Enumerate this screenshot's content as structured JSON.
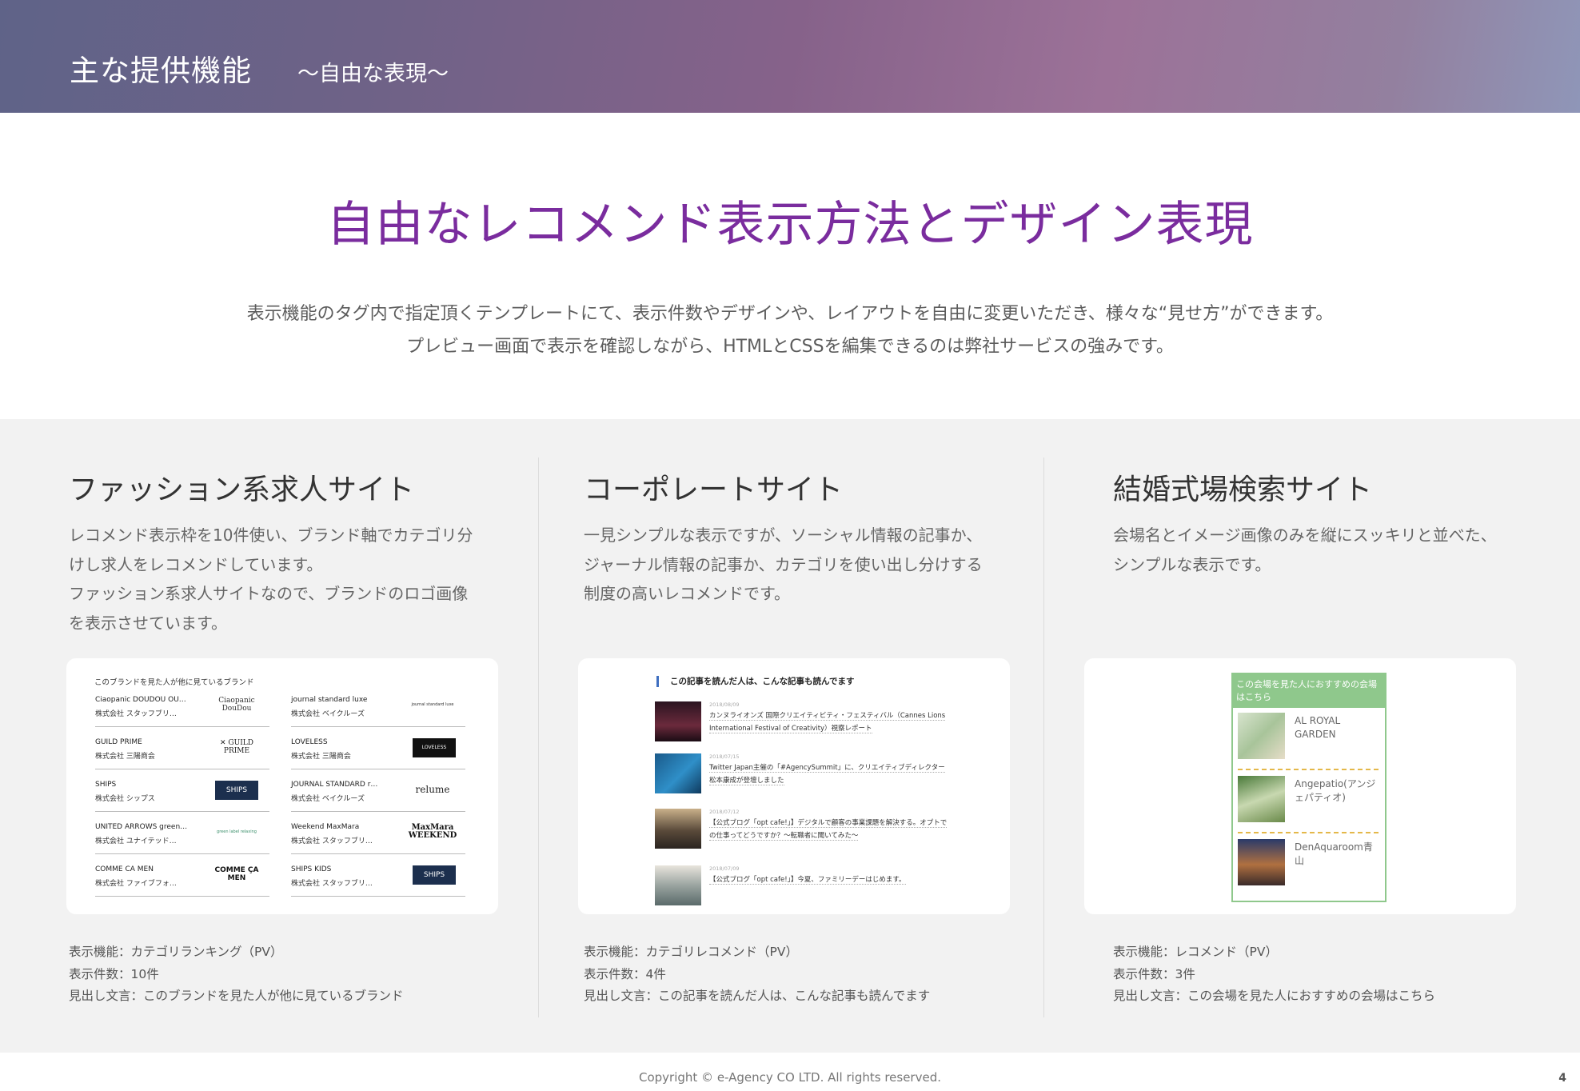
{
  "header": {
    "title": "主な提供機能",
    "subtitle": "～自由な表現～"
  },
  "hero": {
    "title": "自由なレコメンド表示方法とデザイン表現",
    "line1": "表示機能のタグ内で指定頂くテンプレートにて、表示件数やデザインや、レイアウトを自由に変更いただき、様々な“見せ方”ができます。",
    "line2": "プレビュー画面で表示を確認しながら、HTMLとCSSを編集できるのは弊社サービスの強みです。"
  },
  "columns": [
    {
      "title": "ファッション系求人サイト",
      "desc": [
        "レコメンド表示枠を10件使い、ブランド軸でカテゴリ分",
        "けし求人をレコメンドしています。",
        "ファッション系求人サイトなので、ブランドのロゴ画像",
        "を表示させています。"
      ],
      "meta": [
        "表示機能：カテゴリランキング（PV）",
        "表示件数：10件",
        "見出し文言：このブランドを見た人が他に見ているブランド"
      ]
    },
    {
      "title": "コーポレートサイト",
      "desc": [
        "一見シンプルな表示ですが、ソーシャル情報の記事か、",
        "ジャーナル情報の記事か、カテゴリを使い出し分けする",
        "制度の高いレコメンドです。"
      ],
      "meta": [
        "表示機能：カテゴリレコメンド（PV）",
        "表示件数：4件",
        "見出し文言：この記事を読んだ人は、こんな記事も読んでます"
      ]
    },
    {
      "title": "結婚式場検索サイト",
      "desc": [
        "会場名とイメージ画像のみを縦にスッキリと並べた、",
        "シンプルな表示です。"
      ],
      "meta": [
        "表示機能：レコメンド（PV）",
        "表示件数：3件",
        "見出し文言：この会場を見た人におすすめの会場はこちら"
      ]
    }
  ],
  "fashion": {
    "heading": "このブランドを見た人が他に見ているブランド",
    "items": [
      {
        "name": "Ciaopanic DOUDOU OU…",
        "company": "株式会社 スタッフブリ…",
        "logo": "Ciaopanic DouDou"
      },
      {
        "name": "journal standard luxe",
        "company": "株式会社 ベイクルーズ",
        "logo": "journal standard luxe"
      },
      {
        "name": "GUILD PRIME",
        "company": "株式会社 三陽商会",
        "logo": "✕ GUILD PRIME"
      },
      {
        "name": "LOVELESS",
        "company": "株式会社 三陽商会",
        "logo": "LOVELESS"
      },
      {
        "name": "SHIPS",
        "company": "株式会社 シップス",
        "logo": "SHIPS"
      },
      {
        "name": "JOURNAL STANDARD r…",
        "company": "株式会社 ベイクルーズ",
        "logo": "relume"
      },
      {
        "name": "UNITED ARROWS green…",
        "company": "株式会社 ユナイテッド…",
        "logo": "green label relaxing"
      },
      {
        "name": "Weekend MaxMara",
        "company": "株式会社 スタッフブリ…",
        "logo": "MaxMara WEEKEND"
      },
      {
        "name": "COMME CA MEN",
        "company": "株式会社 ファイブフォ…",
        "logo": "COMME ÇA MEN"
      },
      {
        "name": "SHIPS KIDS",
        "company": "株式会社 スタッフブリ…",
        "logo": "SHIPS"
      }
    ]
  },
  "corporate": {
    "heading": "この記事を読んだ人は、こんな記事も読んでます",
    "items": [
      {
        "date": "2018/08/09",
        "text": "カンヌライオンズ 国際クリエイティビティ・フェスティバル（Cannes Lions International Festival of Creativity）視察レポート"
      },
      {
        "date": "2018/07/15",
        "text": "Twitter Japan主催の「#AgencySummit」に、クリエイティブディレクター松本康成が登壇しました"
      },
      {
        "date": "2018/07/12",
        "text": "【公式ブログ「opt cafe!」】デジタルで顧客の事業課題を解決する。オプトでの仕事ってどうですか？～転職者に聞いてみた～"
      },
      {
        "date": "2018/07/09",
        "text": "【公式ブログ「opt cafe!」】今夏、ファミリーデーはじめます。"
      }
    ]
  },
  "wedding": {
    "heading": "この会場を見た人におすすめの会場はこちら",
    "items": [
      "AL ROYAL GARDEN",
      "Angepatio(アンジェパティオ)",
      "DenAquaroom青山"
    ]
  },
  "footer": {
    "copyright": "Copyright © e-Agency CO LTD. All rights reserved.",
    "page": "4"
  }
}
